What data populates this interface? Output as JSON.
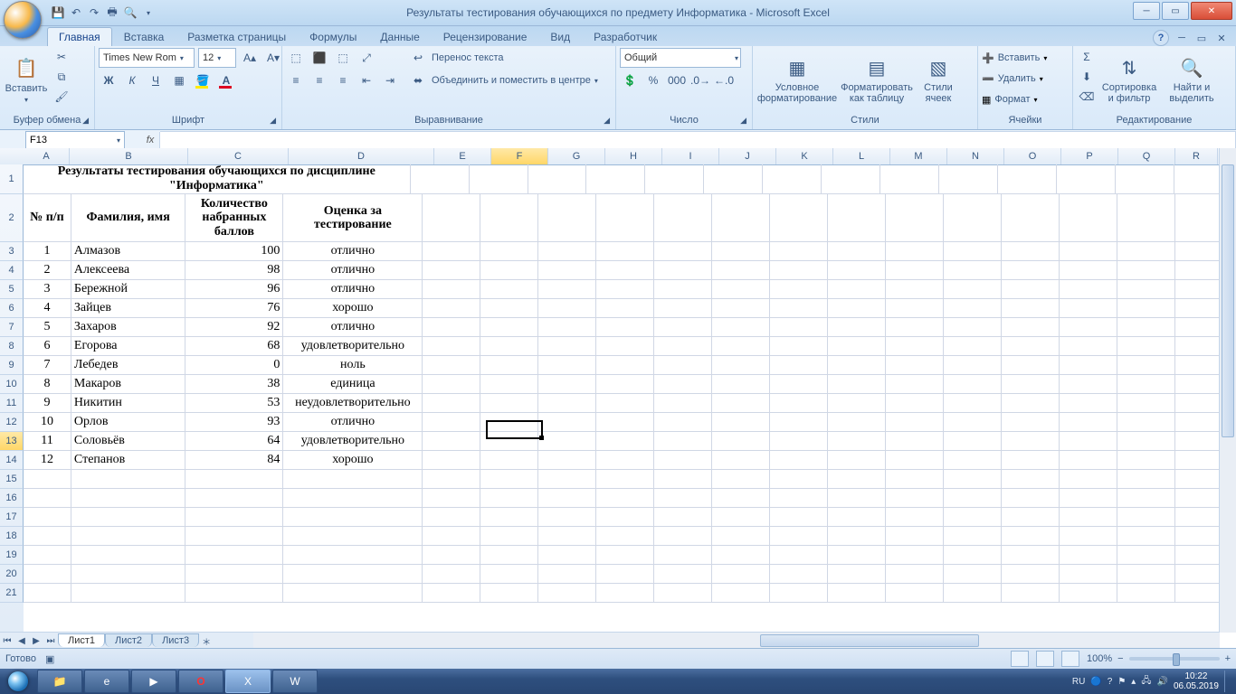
{
  "window": {
    "title": "Результаты тестирования обучающихся по предмету Информатика - Microsoft Excel"
  },
  "qat": {
    "items": [
      "save",
      "undo",
      "redo",
      "quickprint",
      "preview"
    ]
  },
  "tabs": {
    "items": [
      "Главная",
      "Вставка",
      "Разметка страницы",
      "Формулы",
      "Данные",
      "Рецензирование",
      "Вид",
      "Разработчик"
    ],
    "active": 0
  },
  "ribbon": {
    "clipboard": {
      "paste": "Вставить",
      "label": "Буфер обмена"
    },
    "font": {
      "name": "Times New Rom",
      "size": "12",
      "bold": "Ж",
      "italic": "К",
      "underline": "Ч",
      "label": "Шрифт"
    },
    "alignment": {
      "wrap": "Перенос текста",
      "merge": "Объединить и поместить в центре",
      "label": "Выравнивание"
    },
    "number": {
      "format": "Общий",
      "label": "Число"
    },
    "styles": {
      "cond": "Условное форматирование",
      "table": "Форматировать как таблицу",
      "cell": "Стили ячеек",
      "label": "Стили"
    },
    "cells": {
      "insert": "Вставить",
      "delete": "Удалить",
      "format": "Формат",
      "label": "Ячейки"
    },
    "editing": {
      "sort": "Сортировка и фильтр",
      "find": "Найти и выделить",
      "label": "Редактирование"
    }
  },
  "namebox": "F13",
  "columns": [
    {
      "l": "A",
      "w": 50
    },
    {
      "l": "B",
      "w": 130
    },
    {
      "l": "C",
      "w": 110
    },
    {
      "l": "D",
      "w": 160
    },
    {
      "l": "E",
      "w": 62
    },
    {
      "l": "F",
      "w": 62
    },
    {
      "l": "G",
      "w": 62
    },
    {
      "l": "H",
      "w": 62
    },
    {
      "l": "I",
      "w": 62
    },
    {
      "l": "J",
      "w": 62
    },
    {
      "l": "K",
      "w": 62
    },
    {
      "l": "L",
      "w": 62
    },
    {
      "l": "M",
      "w": 62
    },
    {
      "l": "N",
      "w": 62
    },
    {
      "l": "O",
      "w": 62
    },
    {
      "l": "P",
      "w": 62
    },
    {
      "l": "Q",
      "w": 62
    },
    {
      "l": "R",
      "w": 46
    }
  ],
  "rows": [
    {
      "n": 1,
      "h": 32
    },
    {
      "n": 2,
      "h": 52
    },
    {
      "n": 3,
      "h": 20
    },
    {
      "n": 4,
      "h": 20
    },
    {
      "n": 5,
      "h": 20
    },
    {
      "n": 6,
      "h": 20
    },
    {
      "n": 7,
      "h": 20
    },
    {
      "n": 8,
      "h": 20
    },
    {
      "n": 9,
      "h": 20
    },
    {
      "n": 10,
      "h": 20
    },
    {
      "n": 11,
      "h": 20
    },
    {
      "n": 12,
      "h": 20
    },
    {
      "n": 13,
      "h": 20
    },
    {
      "n": 14,
      "h": 20
    },
    {
      "n": 15,
      "h": 20
    },
    {
      "n": 16,
      "h": 20
    },
    {
      "n": 17,
      "h": 20
    },
    {
      "n": 18,
      "h": 20
    },
    {
      "n": 19,
      "h": 20
    },
    {
      "n": 20,
      "h": 20
    },
    {
      "n": 21,
      "h": 20
    }
  ],
  "title_merge": "Результаты тестирования обучающихся по дисциплине \"Информатика\"",
  "headers": {
    "a": "№ п/п",
    "b": "Фамилия, имя",
    "c": "Количество набранных баллов",
    "d": "Оценка за тестирование"
  },
  "data": [
    {
      "n": 1,
      "name": "Алмазов",
      "score": 100,
      "grade": "отлично"
    },
    {
      "n": 2,
      "name": "Алексеева",
      "score": 98,
      "grade": "отлично"
    },
    {
      "n": 3,
      "name": "Бережной",
      "score": 96,
      "grade": "отлично"
    },
    {
      "n": 4,
      "name": "Зайцев",
      "score": 76,
      "grade": "хорошо"
    },
    {
      "n": 5,
      "name": "Захаров",
      "score": 92,
      "grade": "отлично"
    },
    {
      "n": 6,
      "name": "Егорова",
      "score": 68,
      "grade": "удовлетворительно"
    },
    {
      "n": 7,
      "name": "Лебедев",
      "score": 0,
      "grade": "ноль"
    },
    {
      "n": 8,
      "name": "Макаров",
      "score": 38,
      "grade": "единица"
    },
    {
      "n": 9,
      "name": "Никитин",
      "score": 53,
      "grade": "неудовлетворительно"
    },
    {
      "n": 10,
      "name": "Орлов",
      "score": 93,
      "grade": "отлично"
    },
    {
      "n": 11,
      "name": "Соловьёв",
      "score": 64,
      "grade": "удовлетворительно"
    },
    {
      "n": 12,
      "name": "Степанов",
      "score": 84,
      "grade": "хорошо"
    }
  ],
  "selected": {
    "col": "F",
    "row": 13
  },
  "sheets": {
    "active": "Лист1",
    "others": [
      "Лист2",
      "Лист3"
    ]
  },
  "status": {
    "ready": "Готово",
    "zoom": "100%"
  },
  "taskbar": {
    "lang": "RU",
    "time": "10:22",
    "date": "06.05.2019"
  }
}
